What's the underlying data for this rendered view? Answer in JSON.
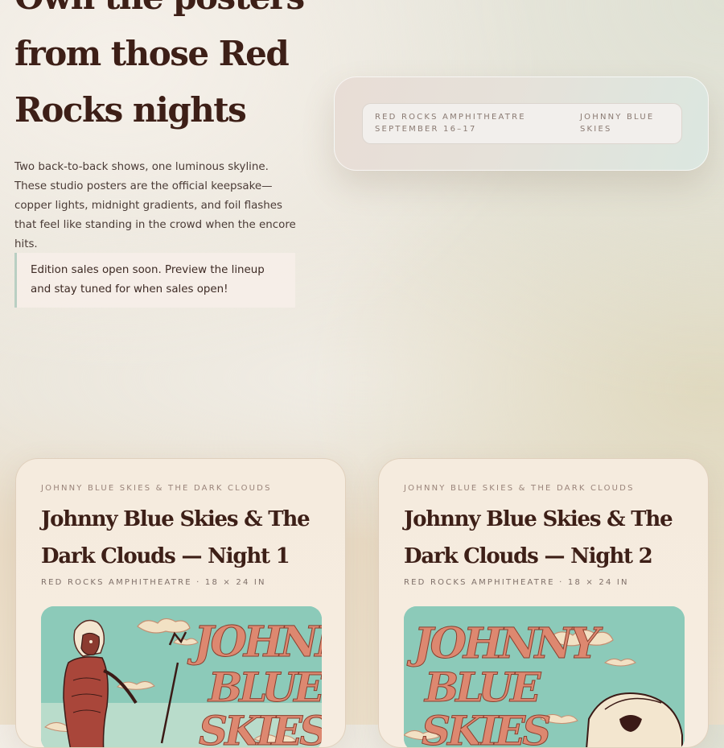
{
  "hero": {
    "title": "Own the posters from those Red Rocks nights",
    "description": "Two back-to-back shows, one luminous skyline. These studio posters are the official keepsake—copper lights, midnight gradients, and foil flashes that feel like standing in the crowd when the encore hits.",
    "notice": "Edition sales open soon. Preview the lineup and stay tuned for when sales open!"
  },
  "event": {
    "venue": "RED ROCKS AMPHITHEATRE",
    "dates": "SEPTEMBER 16–17",
    "artist": "JOHNNY BLUE SKIES"
  },
  "posters": [
    {
      "artist": "JOHNNY BLUE SKIES & THE DARK CLOUDS",
      "title": "Johnny Blue Skies & The Dark Clouds — Night 1",
      "venue_size": "RED ROCKS AMPHITHEATRE · 18 × 24 IN",
      "art_text": "JOHNNY BLUE SKIES"
    },
    {
      "artist": "JOHNNY BLUE SKIES & THE DARK CLOUDS",
      "title": "Johnny Blue Skies & The Dark Clouds — Night 2",
      "venue_size": "RED ROCKS AMPHITHEATRE · 18 × 24 IN",
      "art_text": "JOHNNY BLUE SKIES"
    }
  ],
  "colors": {
    "heading": "#3d1f17",
    "poster_sky": "#8fc9b8",
    "poster_lettering": "#d9826a",
    "notice_border": "#b9cfc2"
  }
}
